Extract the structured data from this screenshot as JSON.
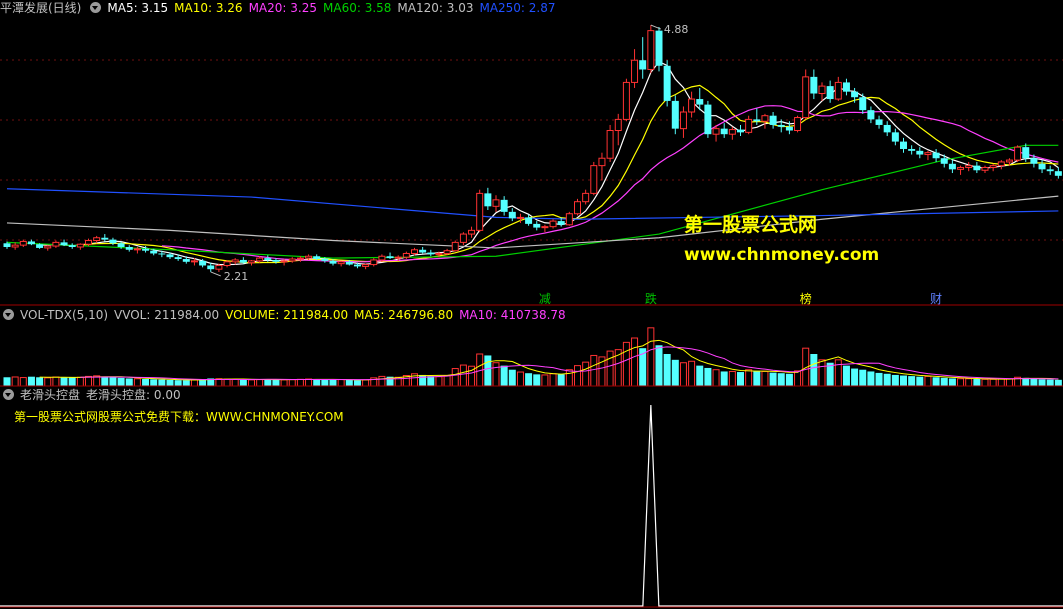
{
  "main_legend": {
    "title": "平潭发展(日线)",
    "items": [
      {
        "label": "MA5: 3.15",
        "color": "#ffffff"
      },
      {
        "label": "MA10: 3.26",
        "color": "#ffff00"
      },
      {
        "label": "MA20: 3.25",
        "color": "#ff40ff"
      },
      {
        "label": "MA60: 3.58",
        "color": "#00d000"
      },
      {
        "label": "MA120: 3.03",
        "color": "#c0c0c0"
      },
      {
        "label": "MA250: 2.87",
        "color": "#2050ff"
      }
    ]
  },
  "vol_legend": {
    "title": "VOL-TDX(5,10)",
    "items": [
      {
        "label": "VVOL: 211984.00",
        "color": "#c0c0c0"
      },
      {
        "label": "VOLUME: 211984.00",
        "color": "#ffff00"
      },
      {
        "label": "MA5: 246796.80",
        "color": "#ffff00"
      },
      {
        "label": "MA10: 410738.78",
        "color": "#ff40ff"
      }
    ]
  },
  "ind_legend": {
    "title": "老滑头控盘",
    "items": [
      {
        "label": "老滑头控盘: 0.00",
        "color": "#c0c0c0"
      }
    ]
  },
  "note": "第一股票公式网股票公式免费下载：WWW.CHNMONEY.COM",
  "watermark": {
    "line1": "第一股票公式网",
    "line2": "www.chnmoney.com"
  },
  "events": [
    {
      "label": "减",
      "color": "#00c000",
      "idx": 66
    },
    {
      "label": "跌",
      "color": "#00c000",
      "idx": 79
    },
    {
      "label": "榜",
      "color": "#ffff00",
      "idx": 98
    },
    {
      "label": "财",
      "color": "#6080ff",
      "idx": 114
    }
  ],
  "colors": {
    "up": "#ff3232",
    "down": "#54ffff",
    "bg": "#000000",
    "separator": "#a00000"
  },
  "chart_data": {
    "type": "candlestick",
    "price_range": [
      1.95,
      5.0
    ],
    "high_label": "4.88",
    "low_label": "2.21",
    "candles": [
      [
        2.52,
        2.54,
        2.46,
        2.48
      ],
      [
        2.48,
        2.53,
        2.45,
        2.5
      ],
      [
        2.5,
        2.56,
        2.48,
        2.54
      ],
      [
        2.54,
        2.56,
        2.5,
        2.51
      ],
      [
        2.51,
        2.52,
        2.46,
        2.47
      ],
      [
        2.47,
        2.5,
        2.44,
        2.49
      ],
      [
        2.49,
        2.55,
        2.47,
        2.53
      ],
      [
        2.53,
        2.56,
        2.49,
        2.5
      ],
      [
        2.5,
        2.52,
        2.46,
        2.48
      ],
      [
        2.48,
        2.52,
        2.45,
        2.51
      ],
      [
        2.51,
        2.57,
        2.49,
        2.55
      ],
      [
        2.55,
        2.6,
        2.52,
        2.58
      ],
      [
        2.58,
        2.62,
        2.54,
        2.56
      ],
      [
        2.56,
        2.58,
        2.5,
        2.52
      ],
      [
        2.52,
        2.54,
        2.46,
        2.48
      ],
      [
        2.48,
        2.5,
        2.43,
        2.45
      ],
      [
        2.45,
        2.48,
        2.41,
        2.46
      ],
      [
        2.46,
        2.49,
        2.42,
        2.44
      ],
      [
        2.44,
        2.46,
        2.39,
        2.41
      ],
      [
        2.41,
        2.44,
        2.37,
        2.4
      ],
      [
        2.4,
        2.42,
        2.35,
        2.37
      ],
      [
        2.37,
        2.4,
        2.33,
        2.35
      ],
      [
        2.35,
        2.38,
        2.3,
        2.32
      ],
      [
        2.32,
        2.36,
        2.28,
        2.33
      ],
      [
        2.33,
        2.35,
        2.26,
        2.28
      ],
      [
        2.28,
        2.31,
        2.21,
        2.24
      ],
      [
        2.24,
        2.3,
        2.21,
        2.28
      ],
      [
        2.28,
        2.34,
        2.26,
        2.32
      ],
      [
        2.32,
        2.36,
        2.29,
        2.34
      ],
      [
        2.34,
        2.37,
        2.3,
        2.31
      ],
      [
        2.31,
        2.34,
        2.28,
        2.33
      ],
      [
        2.33,
        2.38,
        2.31,
        2.36
      ],
      [
        2.36,
        2.39,
        2.32,
        2.34
      ],
      [
        2.34,
        2.36,
        2.3,
        2.32
      ],
      [
        2.32,
        2.35,
        2.28,
        2.33
      ],
      [
        2.33,
        2.37,
        2.31,
        2.35
      ],
      [
        2.35,
        2.38,
        2.32,
        2.36
      ],
      [
        2.36,
        2.4,
        2.34,
        2.38
      ],
      [
        2.38,
        2.4,
        2.34,
        2.35
      ],
      [
        2.35,
        2.37,
        2.31,
        2.33
      ],
      [
        2.33,
        2.35,
        2.28,
        2.3
      ],
      [
        2.3,
        2.33,
        2.27,
        2.32
      ],
      [
        2.32,
        2.34,
        2.28,
        2.29
      ],
      [
        2.29,
        2.31,
        2.25,
        2.27
      ],
      [
        2.27,
        2.3,
        2.24,
        2.29
      ],
      [
        2.29,
        2.36,
        2.27,
        2.34
      ],
      [
        2.34,
        2.4,
        2.32,
        2.38
      ],
      [
        2.38,
        2.42,
        2.35,
        2.36
      ],
      [
        2.36,
        2.39,
        2.33,
        2.37
      ],
      [
        2.37,
        2.43,
        2.35,
        2.41
      ],
      [
        2.41,
        2.47,
        2.39,
        2.45
      ],
      [
        2.45,
        2.48,
        2.41,
        2.42
      ],
      [
        2.42,
        2.45,
        2.38,
        2.4
      ],
      [
        2.4,
        2.43,
        2.37,
        2.41
      ],
      [
        2.41,
        2.46,
        2.39,
        2.44
      ],
      [
        2.44,
        2.55,
        2.43,
        2.53
      ],
      [
        2.53,
        2.64,
        2.5,
        2.62
      ],
      [
        2.62,
        2.7,
        2.58,
        2.66
      ],
      [
        2.66,
        3.1,
        2.64,
        3.06
      ],
      [
        3.06,
        3.12,
        2.88,
        2.92
      ],
      [
        2.92,
        3.04,
        2.86,
        2.99
      ],
      [
        2.99,
        3.03,
        2.82,
        2.86
      ],
      [
        2.86,
        2.9,
        2.76,
        2.79
      ],
      [
        2.79,
        2.84,
        2.74,
        2.8
      ],
      [
        2.8,
        2.83,
        2.71,
        2.73
      ],
      [
        2.73,
        2.76,
        2.66,
        2.69
      ],
      [
        2.69,
        2.72,
        2.64,
        2.7
      ],
      [
        2.7,
        2.78,
        2.68,
        2.76
      ],
      [
        2.76,
        2.8,
        2.7,
        2.72
      ],
      [
        2.72,
        2.86,
        2.71,
        2.84
      ],
      [
        2.84,
        3.0,
        2.82,
        2.97
      ],
      [
        2.97,
        3.1,
        2.94,
        3.06
      ],
      [
        3.06,
        3.4,
        3.04,
        3.36
      ],
      [
        3.36,
        3.5,
        3.2,
        3.44
      ],
      [
        3.44,
        3.8,
        3.4,
        3.74
      ],
      [
        3.74,
        3.92,
        3.58,
        3.86
      ],
      [
        3.86,
        4.3,
        3.84,
        4.26
      ],
      [
        4.26,
        4.62,
        4.2,
        4.5
      ],
      [
        4.5,
        4.75,
        4.3,
        4.4
      ],
      [
        4.4,
        4.88,
        4.36,
        4.82
      ],
      [
        4.82,
        4.86,
        4.38,
        4.44
      ],
      [
        4.44,
        4.5,
        4.0,
        4.06
      ],
      [
        4.06,
        4.12,
        3.7,
        3.76
      ],
      [
        3.76,
        4.0,
        3.66,
        3.94
      ],
      [
        3.94,
        4.16,
        3.88,
        4.08
      ],
      [
        4.08,
        4.2,
        3.96,
        4.02
      ],
      [
        4.02,
        4.06,
        3.66,
        3.7
      ],
      [
        3.7,
        3.8,
        3.62,
        3.76
      ],
      [
        3.76,
        3.82,
        3.66,
        3.7
      ],
      [
        3.7,
        3.78,
        3.64,
        3.75
      ],
      [
        3.75,
        3.8,
        3.68,
        3.72
      ],
      [
        3.72,
        3.9,
        3.7,
        3.86
      ],
      [
        3.86,
        3.98,
        3.8,
        3.84
      ],
      [
        3.84,
        3.92,
        3.76,
        3.9
      ],
      [
        3.9,
        3.94,
        3.76,
        3.8
      ],
      [
        3.8,
        3.86,
        3.72,
        3.78
      ],
      [
        3.78,
        3.84,
        3.7,
        3.74
      ],
      [
        3.74,
        3.9,
        3.72,
        3.88
      ],
      [
        3.88,
        4.4,
        3.86,
        4.32
      ],
      [
        4.32,
        4.4,
        4.08,
        4.14
      ],
      [
        4.14,
        4.26,
        4.06,
        4.22
      ],
      [
        4.22,
        4.28,
        4.04,
        4.08
      ],
      [
        4.08,
        4.32,
        4.06,
        4.26
      ],
      [
        4.26,
        4.3,
        4.12,
        4.16
      ],
      [
        4.16,
        4.2,
        4.04,
        4.1
      ],
      [
        4.1,
        4.14,
        3.92,
        3.96
      ],
      [
        3.96,
        4.0,
        3.82,
        3.86
      ],
      [
        3.86,
        3.9,
        3.76,
        3.8
      ],
      [
        3.8,
        3.84,
        3.68,
        3.72
      ],
      [
        3.72,
        3.76,
        3.58,
        3.62
      ],
      [
        3.62,
        3.66,
        3.5,
        3.54
      ],
      [
        3.54,
        3.58,
        3.48,
        3.52
      ],
      [
        3.52,
        3.56,
        3.44,
        3.48
      ],
      [
        3.48,
        3.52,
        3.42,
        3.5
      ],
      [
        3.5,
        3.54,
        3.4,
        3.44
      ],
      [
        3.44,
        3.48,
        3.34,
        3.38
      ],
      [
        3.38,
        3.42,
        3.28,
        3.32
      ],
      [
        3.32,
        3.36,
        3.26,
        3.34
      ],
      [
        3.34,
        3.4,
        3.3,
        3.36
      ],
      [
        3.36,
        3.4,
        3.28,
        3.31
      ],
      [
        3.31,
        3.36,
        3.28,
        3.34
      ],
      [
        3.34,
        3.38,
        3.3,
        3.36
      ],
      [
        3.36,
        3.42,
        3.32,
        3.4
      ],
      [
        3.4,
        3.44,
        3.36,
        3.42
      ],
      [
        3.42,
        3.58,
        3.4,
        3.56
      ],
      [
        3.56,
        3.6,
        3.4,
        3.44
      ],
      [
        3.44,
        3.48,
        3.34,
        3.38
      ],
      [
        3.38,
        3.42,
        3.28,
        3.32
      ],
      [
        3.32,
        3.36,
        3.26,
        3.3
      ],
      [
        3.3,
        3.34,
        3.22,
        3.25
      ]
    ],
    "volume_range": [
      0,
      2200000
    ],
    "volumes": [
      300000,
      310000,
      290000,
      320000,
      300000,
      280000,
      310000,
      290000,
      300000,
      300000,
      330000,
      350000,
      320000,
      300000,
      280000,
      260000,
      250000,
      240000,
      230000,
      220000,
      210000,
      200000,
      200000,
      210000,
      230000,
      260000,
      250000,
      240000,
      230000,
      220000,
      210000,
      220000,
      230000,
      220000,
      210000,
      220000,
      230000,
      240000,
      230000,
      220000,
      210000,
      220000,
      210000,
      200000,
      210000,
      280000,
      330000,
      320000,
      300000,
      360000,
      420000,
      380000,
      340000,
      320000,
      360000,
      600000,
      720000,
      680000,
      1100000,
      1050000,
      800000,
      700000,
      560000,
      480000,
      440000,
      400000,
      380000,
      420000,
      400000,
      560000,
      700000,
      820000,
      1050000,
      1000000,
      1200000,
      1250000,
      1500000,
      1650000,
      1300000,
      2000000,
      1400000,
      1100000,
      900000,
      800000,
      850000,
      700000,
      620000,
      560000,
      500000,
      500000,
      480000,
      560000,
      520000,
      500000,
      460000,
      440000,
      420000,
      520000,
      1300000,
      1100000,
      900000,
      800000,
      900000,
      700000,
      600000,
      560000,
      500000,
      450000,
      420000,
      380000,
      360000,
      340000,
      320000,
      330000,
      300000,
      280000,
      260000,
      250000,
      250000,
      240000,
      230000,
      230000,
      240000,
      250000,
      300000,
      280000,
      250000,
      230000,
      220000,
      212000
    ],
    "indicator_range": [
      0,
      1
    ],
    "indicator": {
      "spike_index": 79,
      "spike_value": 1,
      "baseline": 0
    },
    "ma_series": [
      {
        "name": "MA5",
        "period": 5,
        "color": "#ffffff"
      },
      {
        "name": "MA10",
        "period": 10,
        "color": "#ffff00"
      },
      {
        "name": "MA20",
        "period": 20,
        "color": "#ff40ff"
      },
      {
        "name": "MA60",
        "color": "#00d000",
        "points": [
          [
            0,
            2.53
          ],
          [
            20,
            2.45
          ],
          [
            40,
            2.36
          ],
          [
            60,
            2.38
          ],
          [
            80,
            2.62
          ],
          [
            100,
            3.1
          ],
          [
            115,
            3.42
          ],
          [
            125,
            3.58
          ],
          [
            129,
            3.58
          ]
        ]
      },
      {
        "name": "MA120",
        "color": "#c0c0c0",
        "points": [
          [
            0,
            2.74
          ],
          [
            20,
            2.66
          ],
          [
            40,
            2.55
          ],
          [
            60,
            2.47
          ],
          [
            80,
            2.58
          ],
          [
            100,
            2.78
          ],
          [
            129,
            3.03
          ]
        ]
      },
      {
        "name": "MA250",
        "color": "#2050ff",
        "points": [
          [
            0,
            3.11
          ],
          [
            30,
            3.02
          ],
          [
            60,
            2.8
          ],
          [
            70,
            2.78
          ],
          [
            100,
            2.82
          ],
          [
            129,
            2.87
          ]
        ]
      }
    ]
  }
}
